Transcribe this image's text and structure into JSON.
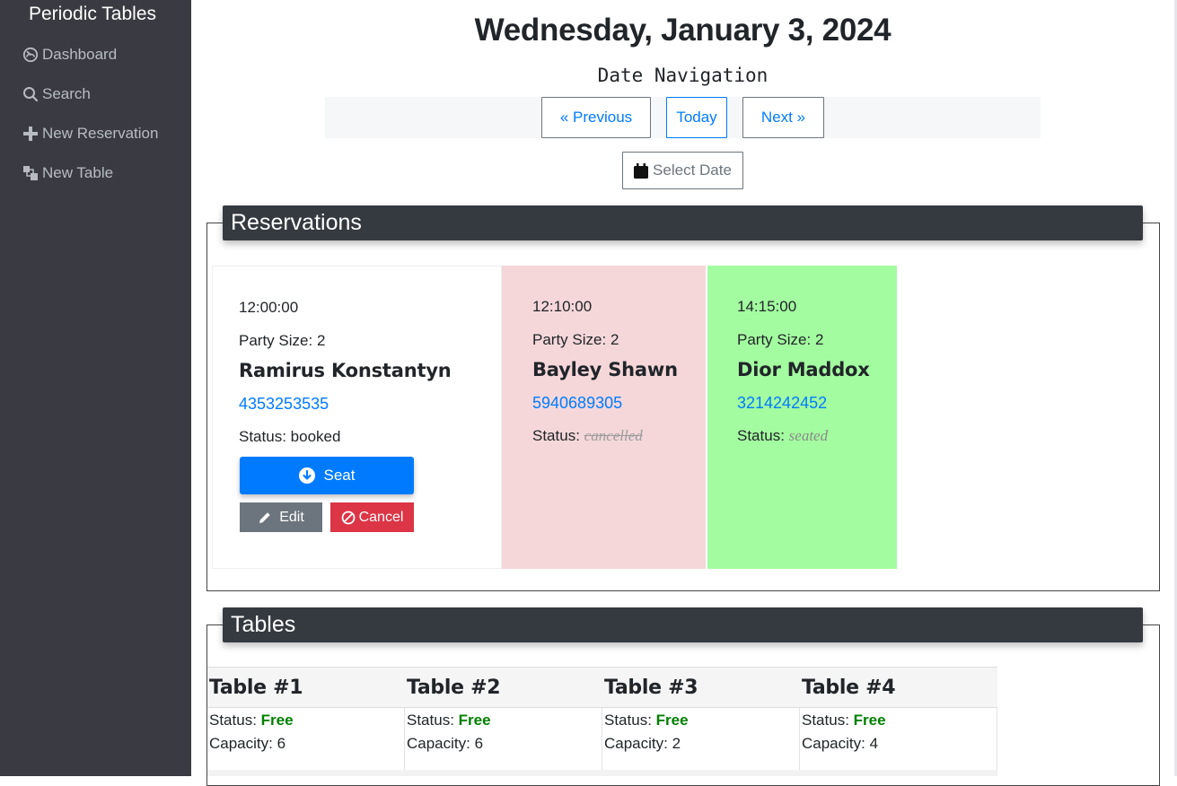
{
  "sidebar": {
    "brand": "Periodic Tables",
    "items": [
      {
        "label": "Dashboard",
        "icon": "dashboard-icon"
      },
      {
        "label": "Search",
        "icon": "search-icon"
      },
      {
        "label": "New Reservation",
        "icon": "plus-icon"
      },
      {
        "label": "New Table",
        "icon": "new-table-icon"
      }
    ]
  },
  "header": {
    "date_title": "Wednesday, January 3, 2024",
    "date_nav_label": "Date Navigation",
    "previous_label": "« Previous",
    "today_label": "Today",
    "next_label": "Next »",
    "select_date_label": "Select Date"
  },
  "reservations": {
    "title": "Reservations",
    "status_prefix": "Status:",
    "party_prefix": "Party Size:",
    "items": [
      {
        "time": "12:00:00",
        "party_size": "2",
        "name": "Ramirus Konstantyn",
        "phone": "4353253535",
        "status": "booked",
        "bg": "#ffffff"
      },
      {
        "time": "12:10:00",
        "party_size": "2",
        "name": "Bayley Shawn",
        "phone": "5940689305",
        "status": "cancelled",
        "bg": "#f5d7da"
      },
      {
        "time": "14:15:00",
        "party_size": "2",
        "name": "Dior Maddox",
        "phone": "3214242452",
        "status": "seated",
        "bg": "#a3fda0"
      }
    ],
    "actions": {
      "seat_label": "Seat",
      "edit_label": "Edit",
      "cancel_label": "Cancel"
    }
  },
  "tables": {
    "title": "Tables",
    "items": [
      {
        "name": "Table #1",
        "status_label": "Status:",
        "status": "Free",
        "capacity_label": "Capacity:",
        "capacity": "6"
      },
      {
        "name": "Table #2",
        "status_label": "Status:",
        "status": "Free",
        "capacity_label": "Capacity:",
        "capacity": "6"
      },
      {
        "name": "Table #3",
        "status_label": "Status:",
        "status": "Free",
        "capacity_label": "Capacity:",
        "capacity": "2"
      },
      {
        "name": "Table #4",
        "status_label": "Status:",
        "status": "Free",
        "capacity_label": "Capacity:",
        "capacity": "4"
      }
    ]
  },
  "colors": {
    "sidebar_bg": "#3a3b42",
    "primary": "#007bff",
    "danger": "#dc3545",
    "secondary": "#6c757d",
    "section_header": "#343a40",
    "free": "#008000"
  }
}
